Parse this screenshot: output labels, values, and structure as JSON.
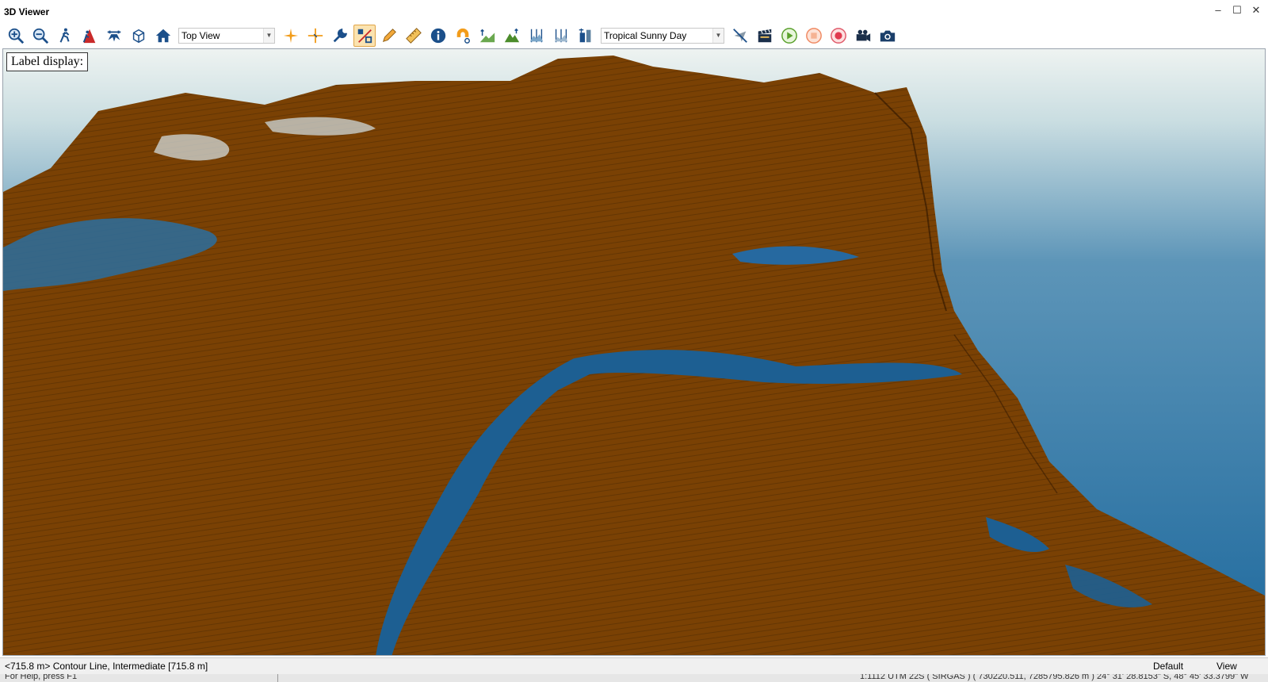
{
  "window": {
    "title": "3D Viewer"
  },
  "toolbar": {
    "view_select": "Top View",
    "sky_select": "Tropical Sunny Day",
    "icons": [
      "zoom-in-icon",
      "zoom-out-icon",
      "walk-icon",
      "fly-person-icon",
      "drone-icon",
      "cube-icon",
      "home-icon",
      "crosshair-star-icon",
      "crosshair-icon",
      "wrench-icon",
      "percent-icon",
      "pencil-icon",
      "ruler-icon",
      "info-icon",
      "magnet-icon",
      "terrain-slope-icon",
      "terrain-mountain-icon",
      "vertical-profile-icon",
      "vertical-profile-2-icon",
      "tower-icon",
      "no-fly-icon",
      "clapper-icon",
      "play-icon",
      "stop-icon",
      "record-icon",
      "video-camera-icon",
      "camera-icon"
    ]
  },
  "viewport": {
    "label_display": "Label display:",
    "colors": {
      "terrain": "#7a4104",
      "water": "#1c5f94",
      "sky_light": "#eef3f1",
      "sky_dark": "#1f6a9e"
    }
  },
  "status": {
    "feature": "<715.8 m> Contour Line, Intermediate [715.8 m]",
    "style": "Default",
    "mode": "View"
  },
  "app_status": {
    "help": "For Help, press F1",
    "coords": "1:1112 UTM 22S ( SIRGAS ) ( 730220.511, 7285795.826 m )  24° 31' 28.8153\" S, 48° 45' 33.3799\" W"
  }
}
